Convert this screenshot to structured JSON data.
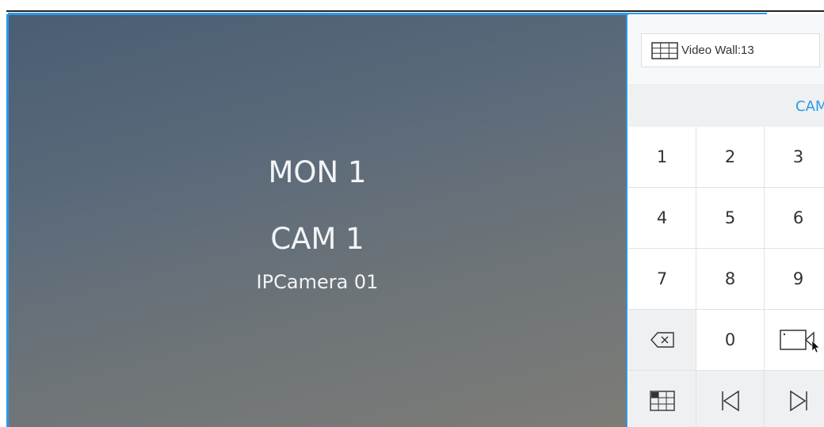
{
  "video": {
    "monitor_label": "MON 1",
    "camera_label": "CAM 1",
    "camera_name": "IPCamera 01"
  },
  "panel": {
    "video_wall_label": "Video Wall:13",
    "mode_header": "CAM",
    "keys": [
      {
        "label": "1"
      },
      {
        "label": "2"
      },
      {
        "label": "3"
      },
      {
        "label": "4"
      },
      {
        "label": "5"
      },
      {
        "label": "6"
      },
      {
        "label": "7"
      },
      {
        "label": "8"
      },
      {
        "label": "9"
      },
      {
        "icon": "backspace-icon"
      },
      {
        "label": "0"
      },
      {
        "icon": "camera-icon"
      },
      {
        "icon": "grid-layout-icon"
      },
      {
        "icon": "previous-icon"
      },
      {
        "icon": "next-icon"
      }
    ]
  },
  "colors": {
    "accent": "#2b9ae8",
    "key_background": "#ffffff",
    "key_background_alt": "#eef0f2",
    "text": "#333333"
  }
}
